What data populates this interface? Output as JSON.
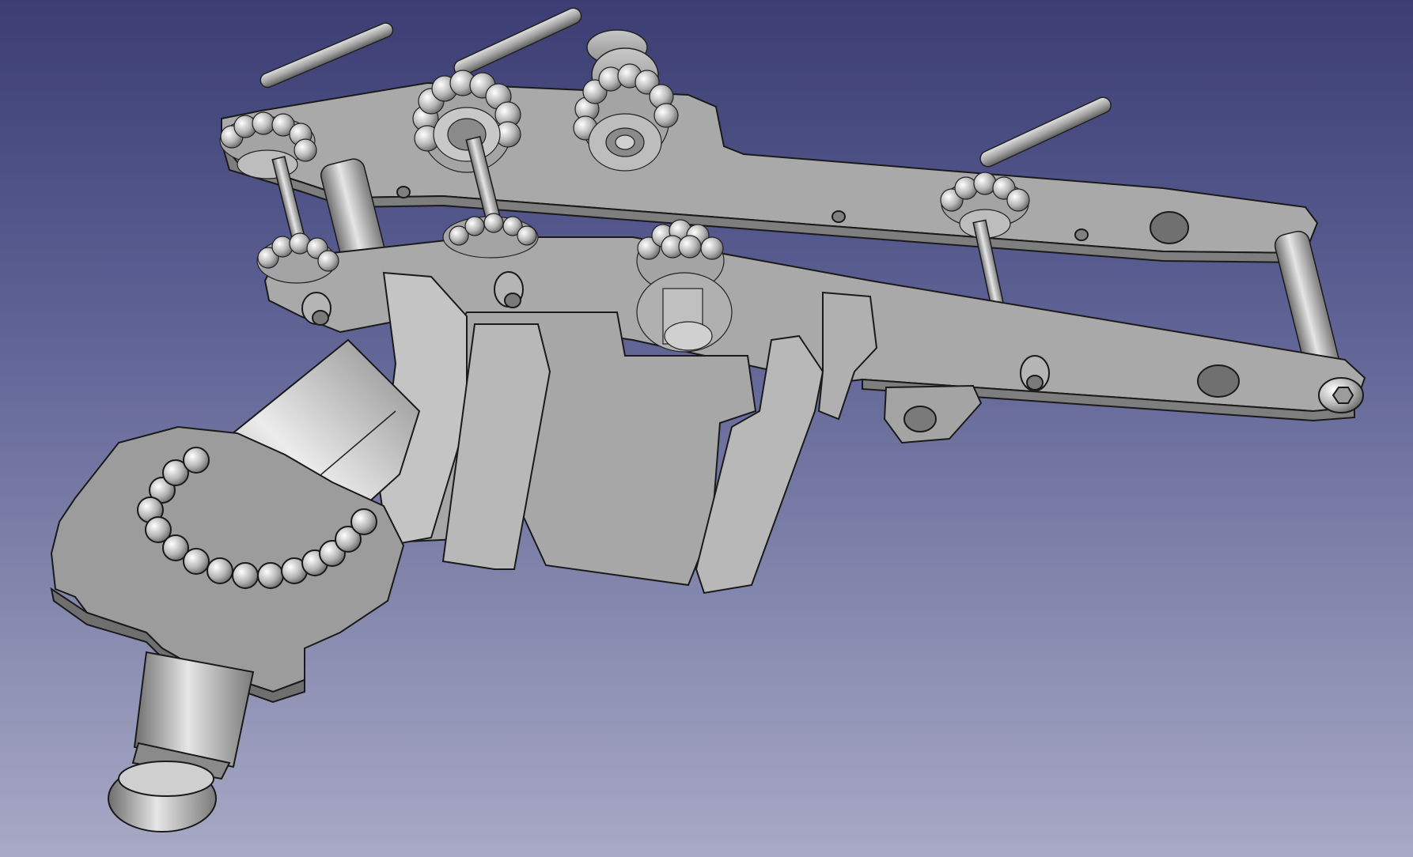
{
  "viewport": {
    "background_top": "#3b3d73",
    "background_bottom": "#a8a9c6",
    "model_color": "#a6a6a6",
    "edge_color": "#1a1a1a"
  },
  "model": {
    "parts": [
      "base-plate",
      "upper-arm",
      "lower-arm",
      "knurled-knobs",
      "handle-rods",
      "cylinder-mount",
      "gear",
      "spindle"
    ]
  }
}
